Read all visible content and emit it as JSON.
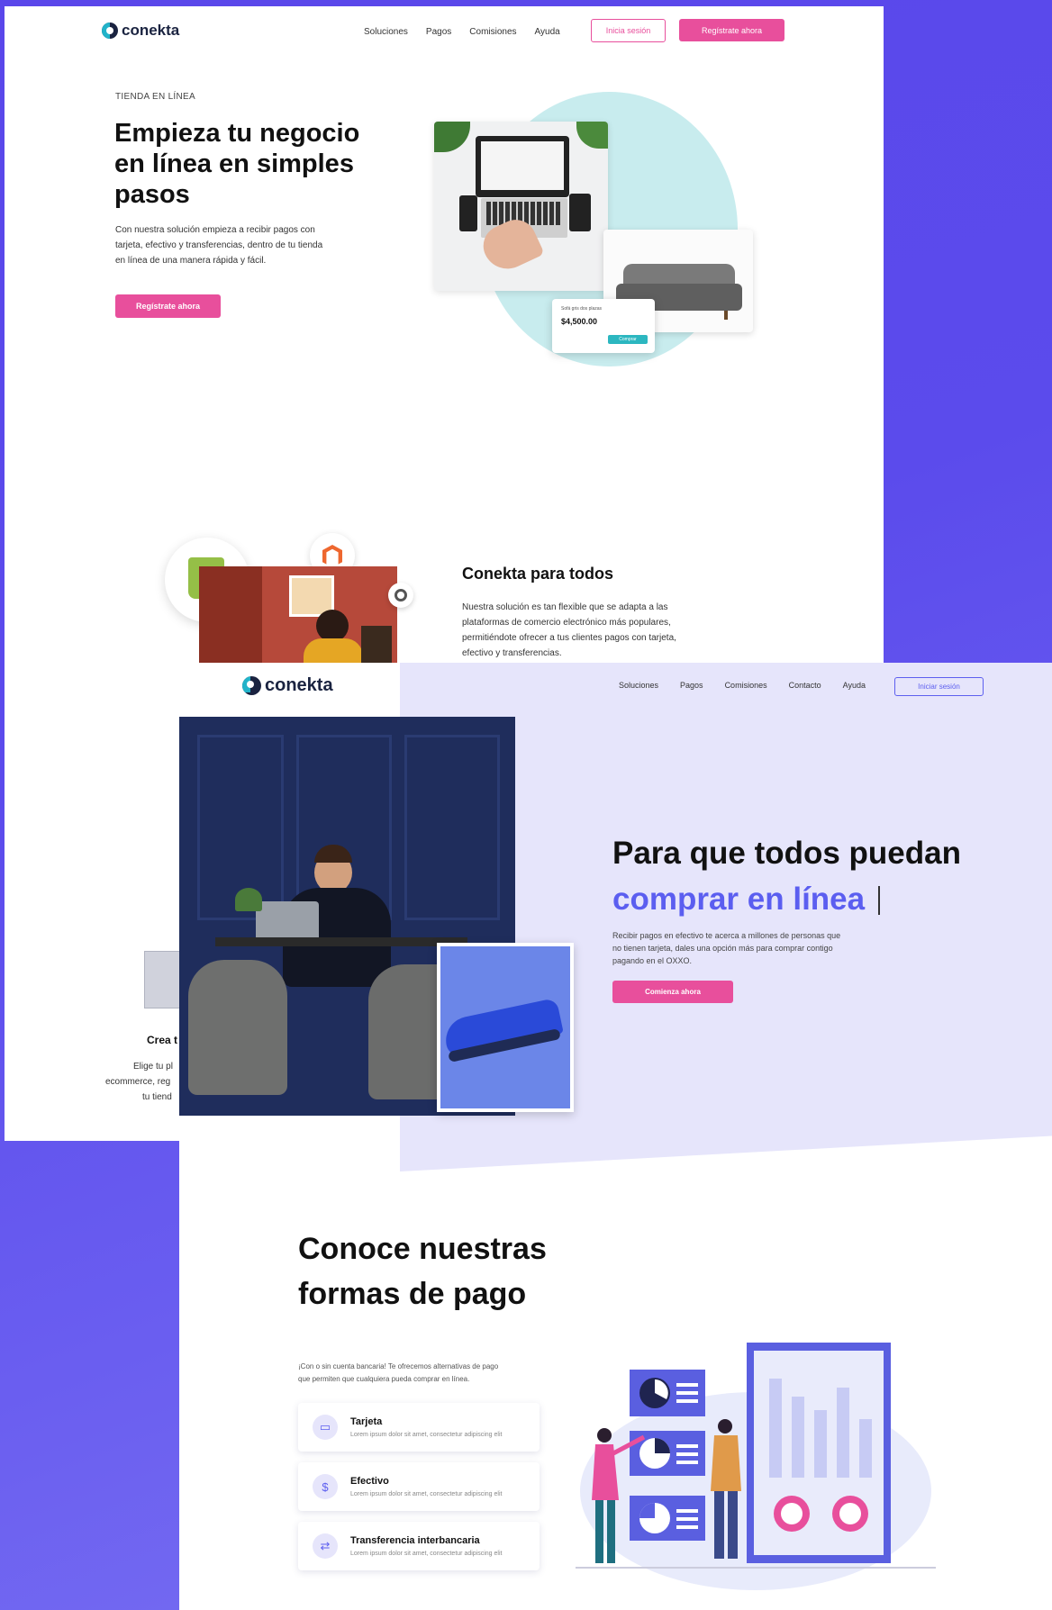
{
  "back": {
    "logo_text": "conekta",
    "nav": [
      "Soluciones",
      "Pagos",
      "Comisiones",
      "Ayuda"
    ],
    "login_label": "Inicia sesión",
    "signup_label": "Regístrate ahora",
    "hero": {
      "eyebrow": "TIENDA EN LÍNEA",
      "title_line1": "Empieza tu negocio",
      "title_line2": "en línea en simples",
      "title_line3": "pasos",
      "desc_line1": "Con nuestra solución empieza a recibir pagos con",
      "desc_line2": "tarjeta, efectivo y transferencias, dentro de tu tienda",
      "desc_line3": "en línea de una manera rápida y fácil.",
      "cta": "Regístrate ahora"
    },
    "product_card": {
      "name": "Sofá gris dos plazas",
      "price": "$4,500.00",
      "button": "Comprar"
    },
    "section2": {
      "title": "Conekta para todos",
      "desc_line1": "Nuestra solución es tan flexible que se adapta a las",
      "desc_line2": "plataformas de comercio electrónico más populares,",
      "desc_line3": "permitiéndote ofrecer a tus clientes pagos con tarjeta,",
      "desc_line4": "efectivo y transferencias."
    },
    "partial": {
      "title": "Crea t",
      "line1": "Elige tu pl",
      "line2": "ecommerce, reg",
      "line3": "tu tiend"
    }
  },
  "front": {
    "logo_text": "conekta",
    "nav": [
      "Soluciones",
      "Pagos",
      "Comisiones",
      "Contacto",
      "Ayuda"
    ],
    "login_label": "Iniciar sesión",
    "hero": {
      "title_line1": "Para que todos puedan",
      "title_line2": "comprar en línea",
      "desc_line1": "Recibir pagos en efectivo te acerca a millones de personas que",
      "desc_line2": "no tienen tarjeta, dales una opción más para comprar contigo",
      "desc_line3": "pagando en el OXXO.",
      "cta": "Comienza ahora"
    },
    "payments": {
      "title_line1": "Conoce nuestras",
      "title_line2": "formas de pago",
      "desc_line1": "¡Con o sin cuenta bancaria! Te ofrecemos alternativas de pago",
      "desc_line2": "que permiten que cualquiera pueda comprar en línea.",
      "methods": [
        {
          "title": "Tarjeta",
          "desc": "Lorem ipsum dolor sit amet, consectetur adipiscing elit",
          "icon": "card-icon"
        },
        {
          "title": "Efectivo",
          "desc": "Lorem ipsum dolor sit amet, consectetur adipiscing elit",
          "icon": "cash-icon"
        },
        {
          "title": "Transferencia interbancaria",
          "desc": "Lorem ipsum dolor sit amet, consectetur adipiscing elit",
          "icon": "transfer-icon"
        }
      ]
    }
  },
  "colors": {
    "background": "#5b4bec",
    "pink": "#e84f9c",
    "blue": "#5b5ef0",
    "lavender": "#e6e5fb",
    "teal_circle": "#c8ecee"
  }
}
